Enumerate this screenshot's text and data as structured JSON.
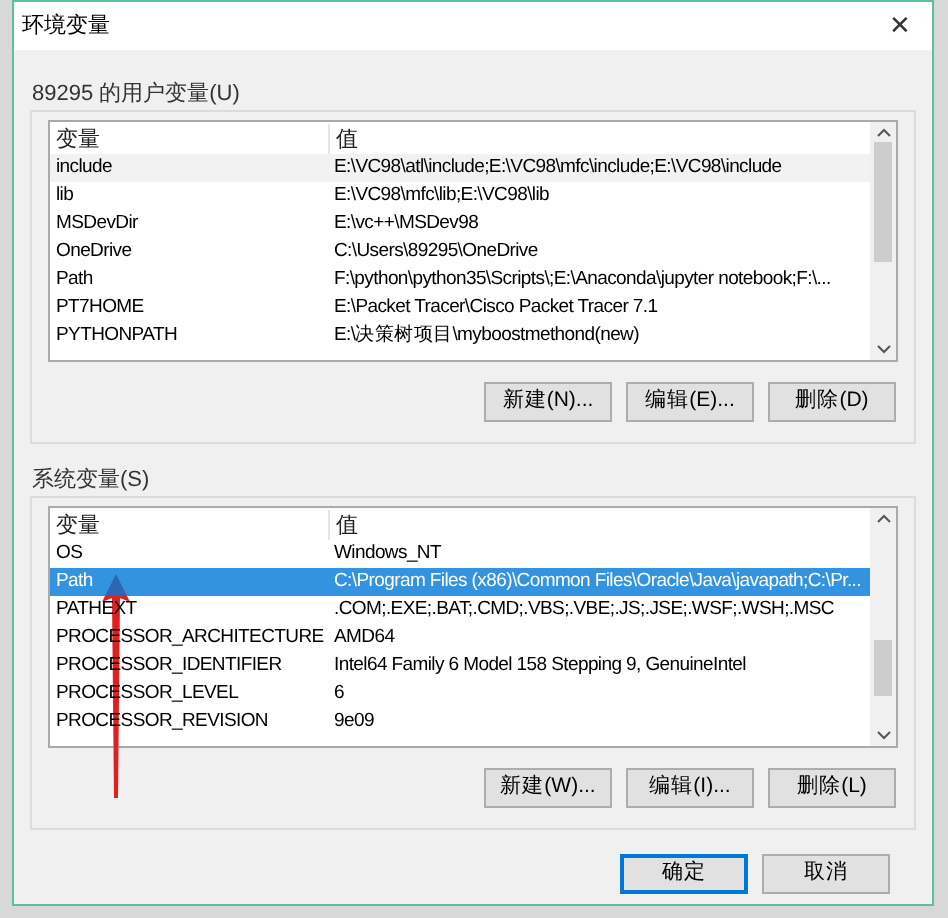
{
  "window": {
    "title": "环境变量",
    "close": "✕"
  },
  "user_vars": {
    "label": "89295 的用户变量(U)",
    "columns": [
      "变量",
      "值"
    ],
    "rows": [
      {
        "name": "include",
        "value": "E:\\VC98\\atl\\include;E:\\VC98\\mfc\\include;E:\\VC98\\include",
        "selected": false
      },
      {
        "name": "lib",
        "value": "E:\\VC98\\mfc\\lib;E:\\VC98\\lib",
        "selected": false
      },
      {
        "name": "MSDevDir",
        "value": "E:\\vc++\\MSDev98",
        "selected": false
      },
      {
        "name": "OneDrive",
        "value": "C:\\Users\\89295\\OneDrive",
        "selected": false
      },
      {
        "name": "Path",
        "value": "F:\\python\\python35\\Scripts\\;E:\\Anaconda\\jupyter notebook;F:\\...",
        "selected": false
      },
      {
        "name": "PT7HOME",
        "value": "E:\\Packet Tracer\\Cisco Packet Tracer 7.1",
        "selected": false
      },
      {
        "name": "PYTHONPATH",
        "value": "E:\\决策树项目\\myboostmethond(new)",
        "selected": false
      }
    ],
    "buttons": [
      "新建(N)...",
      "编辑(E)...",
      "删除(D)"
    ]
  },
  "system_vars": {
    "label": "系统变量(S)",
    "columns": [
      "变量",
      "值"
    ],
    "rows": [
      {
        "name": "OS",
        "value": "Windows_NT",
        "selected": false
      },
      {
        "name": "Path",
        "value": "C:\\Program Files (x86)\\Common Files\\Oracle\\Java\\javapath;C:\\Pr...",
        "selected": true
      },
      {
        "name": "PATHEXT",
        "value": ".COM;.EXE;.BAT;.CMD;.VBS;.VBE;.JS;.JSE;.WSF;.WSH;.MSC",
        "selected": false
      },
      {
        "name": "PROCESSOR_ARCHITECTURE",
        "value": "AMD64",
        "selected": false
      },
      {
        "name": "PROCESSOR_IDENTIFIER",
        "value": "Intel64 Family 6 Model 158 Stepping 9, GenuineIntel",
        "selected": false
      },
      {
        "name": "PROCESSOR_LEVEL",
        "value": "6",
        "selected": false
      },
      {
        "name": "PROCESSOR_REVISION",
        "value": "9e09",
        "selected": false
      }
    ],
    "buttons": [
      "新建(W)...",
      "编辑(I)...",
      "删除(L)"
    ]
  },
  "footer_buttons": [
    {
      "label": "确定",
      "kind": "default"
    },
    {
      "label": "取消",
      "kind": "normal"
    }
  ]
}
